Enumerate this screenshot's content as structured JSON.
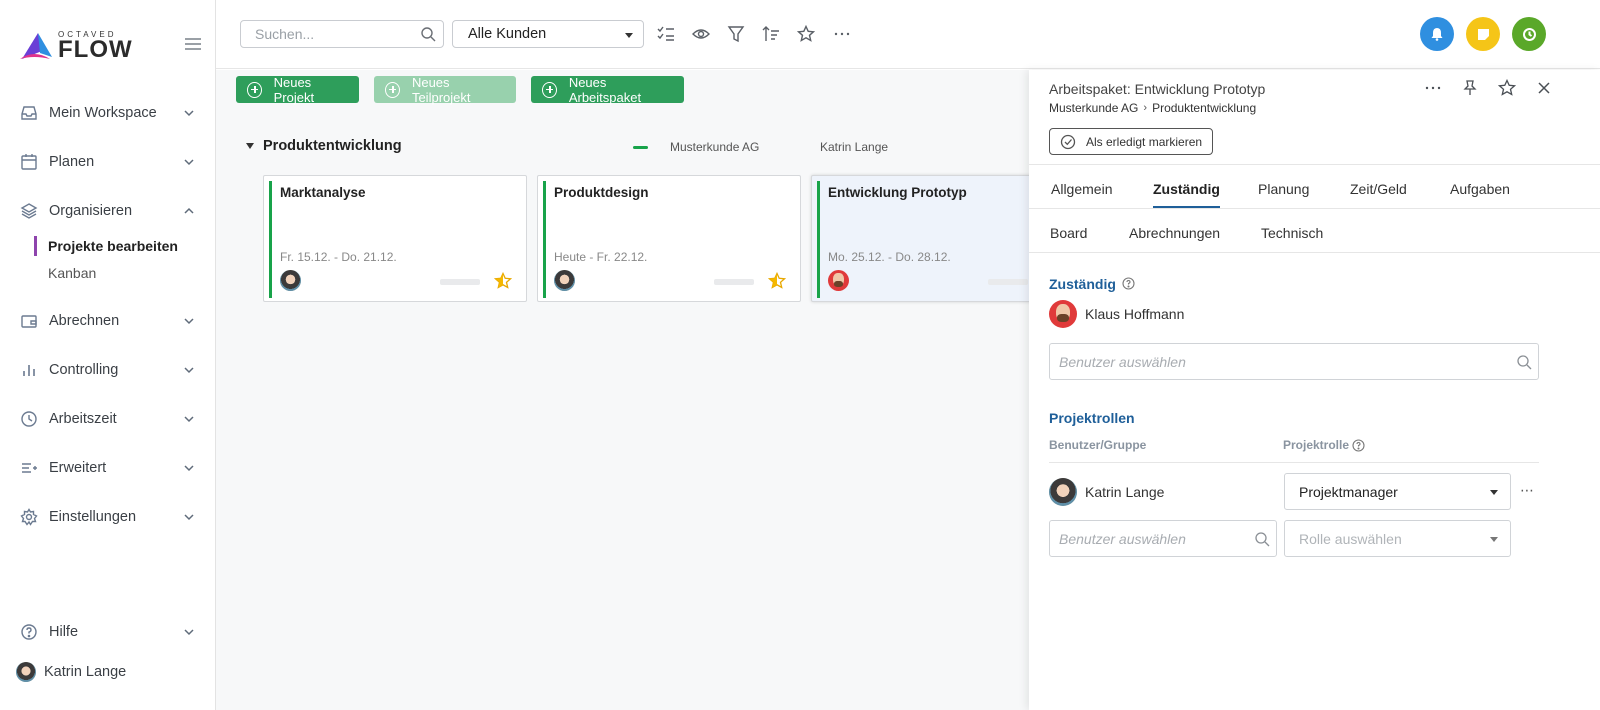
{
  "brand": {
    "small": "OCTAVED",
    "big": "FLOW"
  },
  "sidebar": {
    "items": [
      {
        "label": "Mein Workspace",
        "icon": "inbox-icon"
      },
      {
        "label": "Planen",
        "icon": "calendar-icon"
      },
      {
        "label": "Organisieren",
        "icon": "layers-icon"
      },
      {
        "label": "Abrechnen",
        "icon": "wallet-icon"
      },
      {
        "label": "Controlling",
        "icon": "bar-chart-icon"
      },
      {
        "label": "Arbeitszeit",
        "icon": "clock-icon"
      },
      {
        "label": "Erweitert",
        "icon": "list-plus-icon"
      },
      {
        "label": "Einstellungen",
        "icon": "gear-icon"
      }
    ],
    "sub_items": [
      {
        "label": "Projekte bearbeiten",
        "active": true
      },
      {
        "label": "Kanban",
        "active": false
      }
    ],
    "help": "Hilfe",
    "user": "Katrin Lange"
  },
  "topbar": {
    "search_placeholder": "Suchen...",
    "customer_filter": "Alle Kunden",
    "colors": {
      "bell": "#2f8fe0",
      "note": "#f5c518",
      "clock": "#5aa829"
    }
  },
  "toolbar": {
    "new_project": "Neues Projekt",
    "new_subproject": "Neues Teilprojekt",
    "new_workpackage": "Neues Arbeitspaket"
  },
  "board": {
    "group": {
      "title": "Produktentwicklung",
      "customer": "Musterkunde AG",
      "owner": "Katrin Lange"
    },
    "cards": [
      {
        "title": "Marktanalyse",
        "dates": "Fr. 15.12. - Do. 21.12."
      },
      {
        "title": "Produktdesign",
        "dates": "Heute - Fr. 22.12."
      },
      {
        "title": "Entwicklung Prototyp",
        "dates": "Mo. 25.12. - Do. 28.12."
      }
    ]
  },
  "panel": {
    "title": "Arbeitspaket: Entwicklung Prototyp",
    "breadcrumb": [
      "Musterkunde AG",
      "Produktentwicklung"
    ],
    "mark_done": "Als erledigt markieren",
    "tabs_row1": [
      "Allgemein",
      "Zuständig",
      "Planung",
      "Zeit/Geld",
      "Aufgaben"
    ],
    "tabs_row2": [
      "Board",
      "Abrechnungen",
      "Technisch"
    ],
    "active_tab": "Zuständig",
    "assigned": {
      "title": "Zuständig",
      "user": "Klaus Hoffmann",
      "placeholder": "Benutzer auswählen"
    },
    "roles": {
      "title": "Projektrollen",
      "col_user": "Benutzer/Gruppe",
      "col_role": "Projektrolle",
      "rows": [
        {
          "user": "Katrin Lange",
          "role": "Projektmanager"
        }
      ],
      "user_placeholder": "Benutzer auswählen",
      "role_placeholder": "Rolle auswählen"
    }
  }
}
